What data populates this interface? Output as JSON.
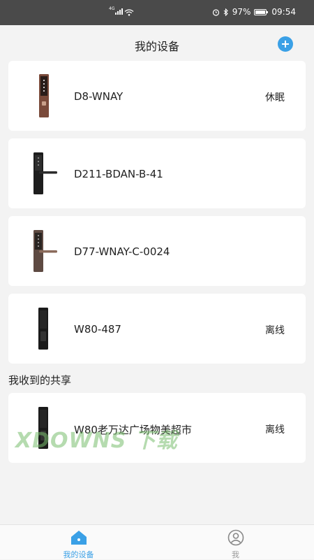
{
  "status_bar": {
    "network": "4G",
    "battery": "97%",
    "battery_level": 0.97,
    "time": "09:54"
  },
  "header": {
    "title": "我的设备",
    "add_icon": "plus-circle-icon"
  },
  "devices": [
    {
      "name": "D8-WNAY",
      "status": "休眠"
    },
    {
      "name": "D211-BDAN-B-41",
      "status": ""
    },
    {
      "name": "D77-WNAY-C-0024",
      "status": ""
    },
    {
      "name": "W80-487",
      "status": "离线"
    }
  ],
  "shared": {
    "title": "我收到的共享",
    "devices": [
      {
        "name": "W80老万达广场物美超市",
        "status": "离线"
      }
    ]
  },
  "watermark": "XDOWNS 下载",
  "tabbar": {
    "tabs": [
      {
        "label": "我的设备",
        "icon": "home-icon",
        "active": true
      },
      {
        "label": "我",
        "icon": "user-icon",
        "active": false
      }
    ]
  },
  "colors": {
    "accent": "#3aa0e6",
    "status_bar_bg": "#4a4a4a",
    "page_bg": "#f3f3f3"
  }
}
